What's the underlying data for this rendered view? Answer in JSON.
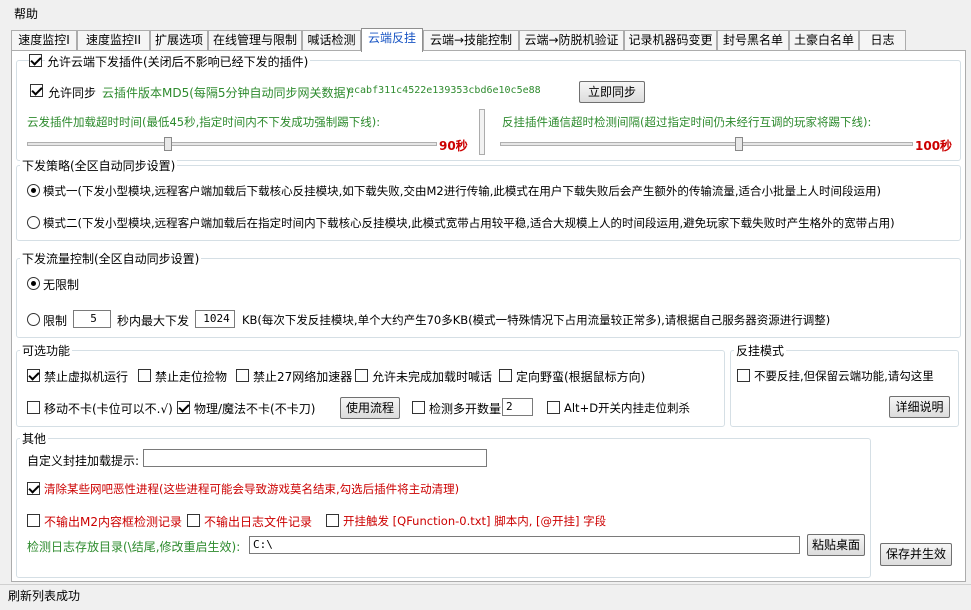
{
  "menu": {
    "help": "帮助"
  },
  "tabs": [
    "速度监控I",
    "速度监控II",
    "扩展选项",
    "在线管理与限制",
    "喊话检测",
    "云端反挂",
    "云端→技能控制",
    "云端→防脱机验证",
    "记录机器码变更",
    "封号黑名单",
    "土豪白名单",
    "日志"
  ],
  "cloud": {
    "allow_label": "允许云端下发插件(关闭后不影响已经下发的插件)",
    "allow_sync_label": "允许同步",
    "version_label": "云插件版本MD5(每隔5分钟自动同步网关数据):",
    "md5": "ecabf311c4522e139353cbd6e10c5e88",
    "sync_button": "立即同步",
    "load_timeout_label": "云发插件加载超时时间(最低45秒,指定时间内不下发成功强制踢下线):",
    "load_timeout_value": "90秒",
    "load_timeout_level": 0.34,
    "comm_timeout_label": "反挂插件通信超时检测间隔(超过指定时间仍未经行互调的玩家将踢下线):",
    "comm_timeout_value": "100秒",
    "comm_timeout_level": 0.58
  },
  "strategy": {
    "title": "下发策略(全区自动同步设置)",
    "mode1": "模式一(下发小型模块,远程客户端加载后下载核心反挂模块,如下载失败,交由M2进行传输,此模式在用户下载失败后会产生额外的传输流量,适合小批量上人时间段运用)",
    "mode2": "模式二(下发小型模块,远程客户端加载后在指定时间内下载核心反挂模块,此模式宽带占用较平稳,适合大规模上人的时间段运用,避免玩家下载失败时产生格外的宽带占用)"
  },
  "traffic": {
    "title": "下发流量控制(全区自动同步设置)",
    "unlimited": "无限制",
    "limit": "限制",
    "limit_value": "5",
    "per_sec": "秒内最大下发",
    "kb_value": "1024",
    "kb_note": "KB(每次下发反挂模块,单个大约产生70多KB(模式一特殊情况下占用流量较正常多),请根据自己服务器资源进行调整)"
  },
  "optional": {
    "title": "可选功能",
    "vm": "禁止虚拟机运行",
    "walk_pick": "禁止走位捡物",
    "net27": "禁止27网络加速器",
    "shout": "允许未完成加载时喊话",
    "locate": "定向野蛮(根据鼠标方向)",
    "move_nolag": "移动不卡(卡位可以不.√)",
    "magic_nolag": "物理/魔法不卡(不卡刀)",
    "flow_button": "使用流程",
    "multi": "检测多开数量",
    "multi_value": "2",
    "altd": "Alt+D开关内挂走位刺杀"
  },
  "antimode": {
    "title": "反挂模式",
    "no_anti": "不要反挂,但保留云端功能,请勾这里",
    "detail_button": "详细说明"
  },
  "other": {
    "title": "其他",
    "custom_label": "自定义封挂加载提示:",
    "custom_value": "",
    "clear_label": "清除某些网吧恶性进程(这些进程可能会导致游戏莫名结束,勾选后插件将主动清理)",
    "no_m2": "不输出M2内容框检测记录",
    "no_log": "不输出日志文件记录",
    "hook": "开挂触发 [QFunction-0.txt] 脚本内, [@开挂] 字段",
    "dir_label": "检测日志存放目录(\\结尾,修改重启生效):",
    "dir_value": "C:\\",
    "paste_button": "粘贴桌面"
  },
  "save_button": "保存并生效",
  "status": "刷新列表成功",
  "colors": {
    "accent_green": "#2e8b2e",
    "accent_red": "#cc0000",
    "tab_active": "#1a56c4"
  }
}
